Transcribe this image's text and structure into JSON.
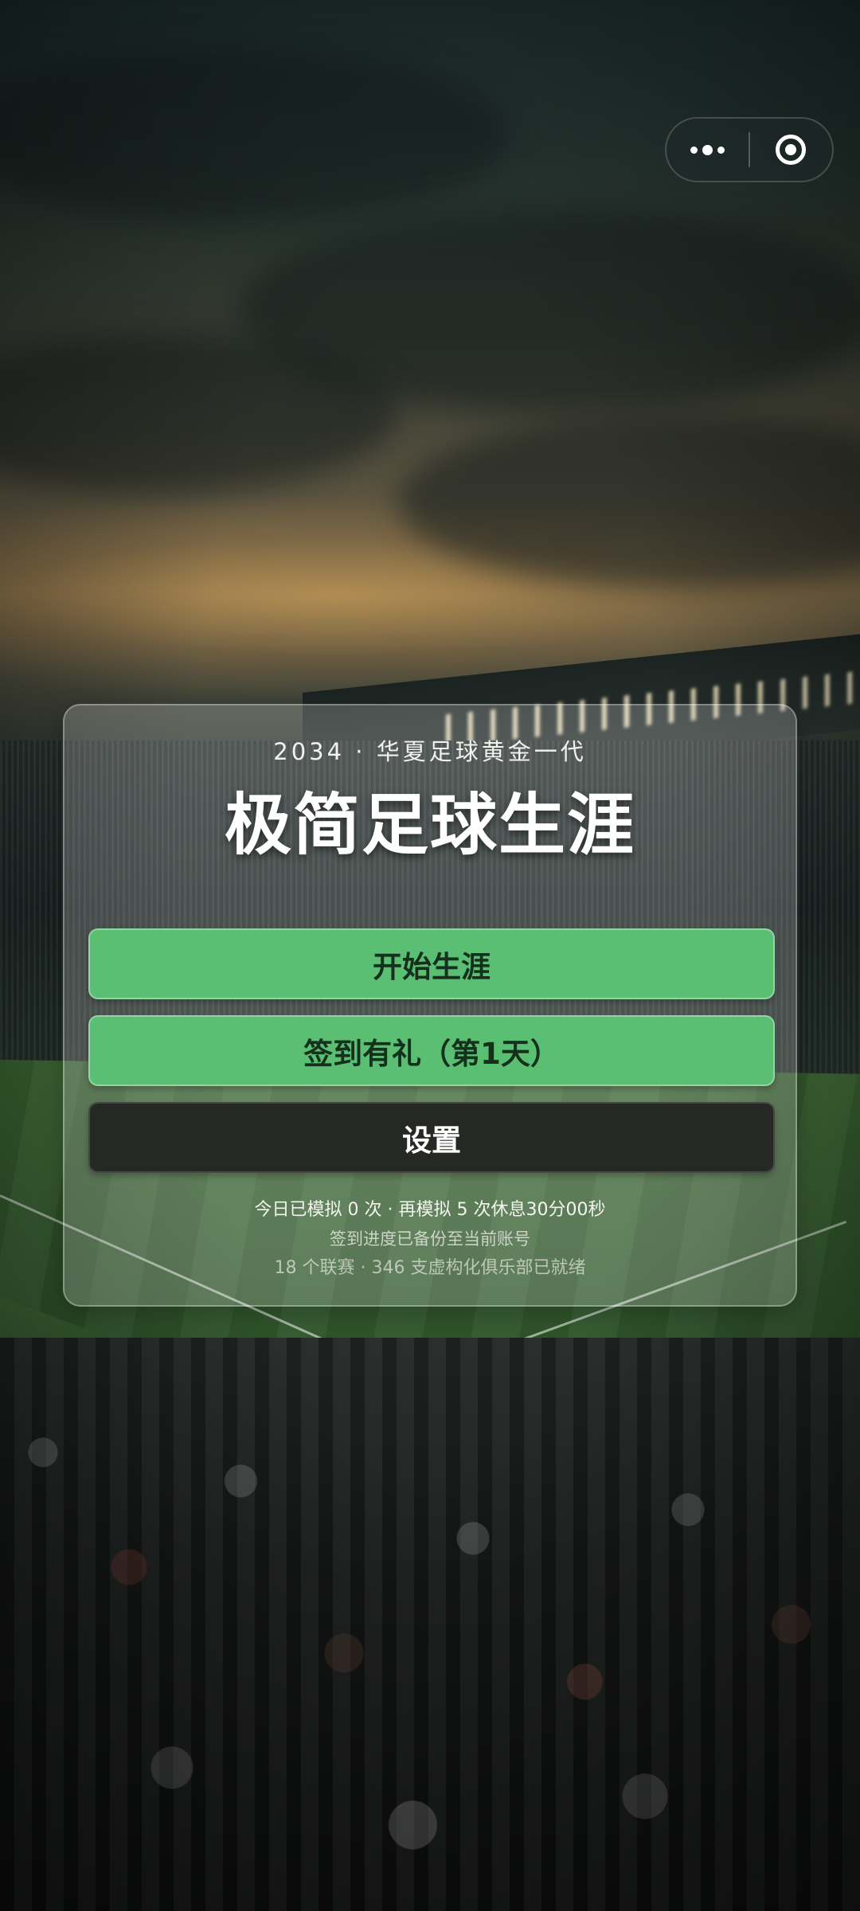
{
  "capsule": {
    "more_icon": "more-dots-icon",
    "close_icon": "target-close-icon"
  },
  "card": {
    "subtitle": "2034 · 华夏足球黄金一代",
    "title": "极简足球生涯",
    "buttons": {
      "start": "开始生涯",
      "signin": "签到有礼（第1天）",
      "settings": "设置"
    },
    "info": {
      "line1": "今日已模拟 0 次 · 再模拟 5 次休息30分00秒",
      "line2": "签到进度已备份至当前账号",
      "line3": "18 个联赛 · 346 支虚构化俱乐部已就绪"
    }
  },
  "colors": {
    "primary_button": "#5abf72",
    "secondary_button": "#252823"
  }
}
